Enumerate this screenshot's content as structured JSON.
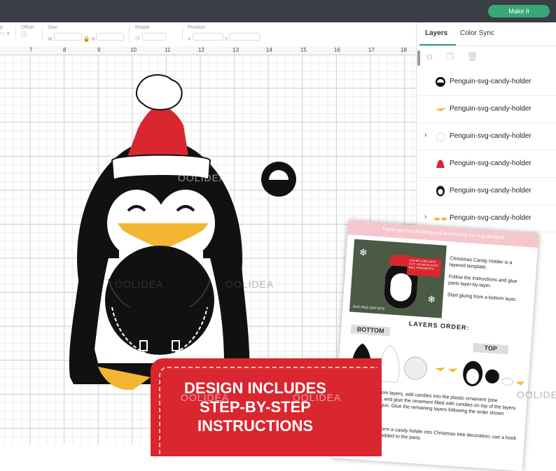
{
  "header": {
    "make_it_label": "Make It"
  },
  "toolbar": {
    "offset_label": "Offset",
    "size_label": "Size",
    "w_label": "W",
    "h_label": "H",
    "rotate_label": "Rotate",
    "position_label": "Position",
    "x_label": "X",
    "y_label": "Y"
  },
  "ruler": {
    "numbers": [
      "7",
      "8",
      "9",
      "10",
      "11",
      "12",
      "13",
      "14",
      "15",
      "16",
      "17",
      "18"
    ]
  },
  "panel": {
    "tabs": [
      {
        "label": "Layers"
      },
      {
        "label": "Color Sync"
      }
    ],
    "layers": [
      {
        "name": "Penguin-svg-candy-holder",
        "thumb": "black-dome"
      },
      {
        "name": "Penguin-svg-candy-holder",
        "thumb": "yellow-beak"
      },
      {
        "name": "Penguin-svg-candy-holder",
        "thumb": "white-outline"
      },
      {
        "name": "Penguin-svg-candy-holder",
        "thumb": "red-hat"
      },
      {
        "name": "Penguin-svg-candy-holder",
        "thumb": "black-penguin"
      },
      {
        "name": "Penguin-svg-candy-holder",
        "thumb": "yellow-feet"
      }
    ]
  },
  "watermark": {
    "text": "OOLIDEA"
  },
  "instructions_card": {
    "header": "Thank you for choosing and purchasing our svg designs!",
    "photo_badge": "CAN BE USED WITH 3.15\" / 80 MM PLASTIC BALL ORNAMENTS",
    "formats": "SVG  PNG  DXF  EPS",
    "intro": "Christmas Candy Holder is a layered template.",
    "follow": "Follow the instructions and glue parts layer-by-layer.",
    "start": "Start gluing from a bottom layer.",
    "layers_order": "LAYERS ORDER:",
    "bottom": "BOTTOM",
    "top": "TOP",
    "glue_text": "Glue two (2) bottom layers, add candies into the plastic ornament (one half/hemisphere), and glue the ornament filled with candies on top of the layers using a hot glue gun. Glue the remaining layers following the order shown above.",
    "transform_text": "To transform a candy holder into Christmas tree decoration, use a hook which is added to the parts"
  },
  "banner": {
    "lines": [
      "DESIGN INCLUDES",
      "STEP-BY-STEP",
      "INSTRUCTIONS"
    ]
  },
  "colors": {
    "topbar": "#3a3f45",
    "accent": "#3aa876",
    "hat_red": "#d9262f",
    "beak": "#f2b632",
    "penguin": "#111111"
  }
}
